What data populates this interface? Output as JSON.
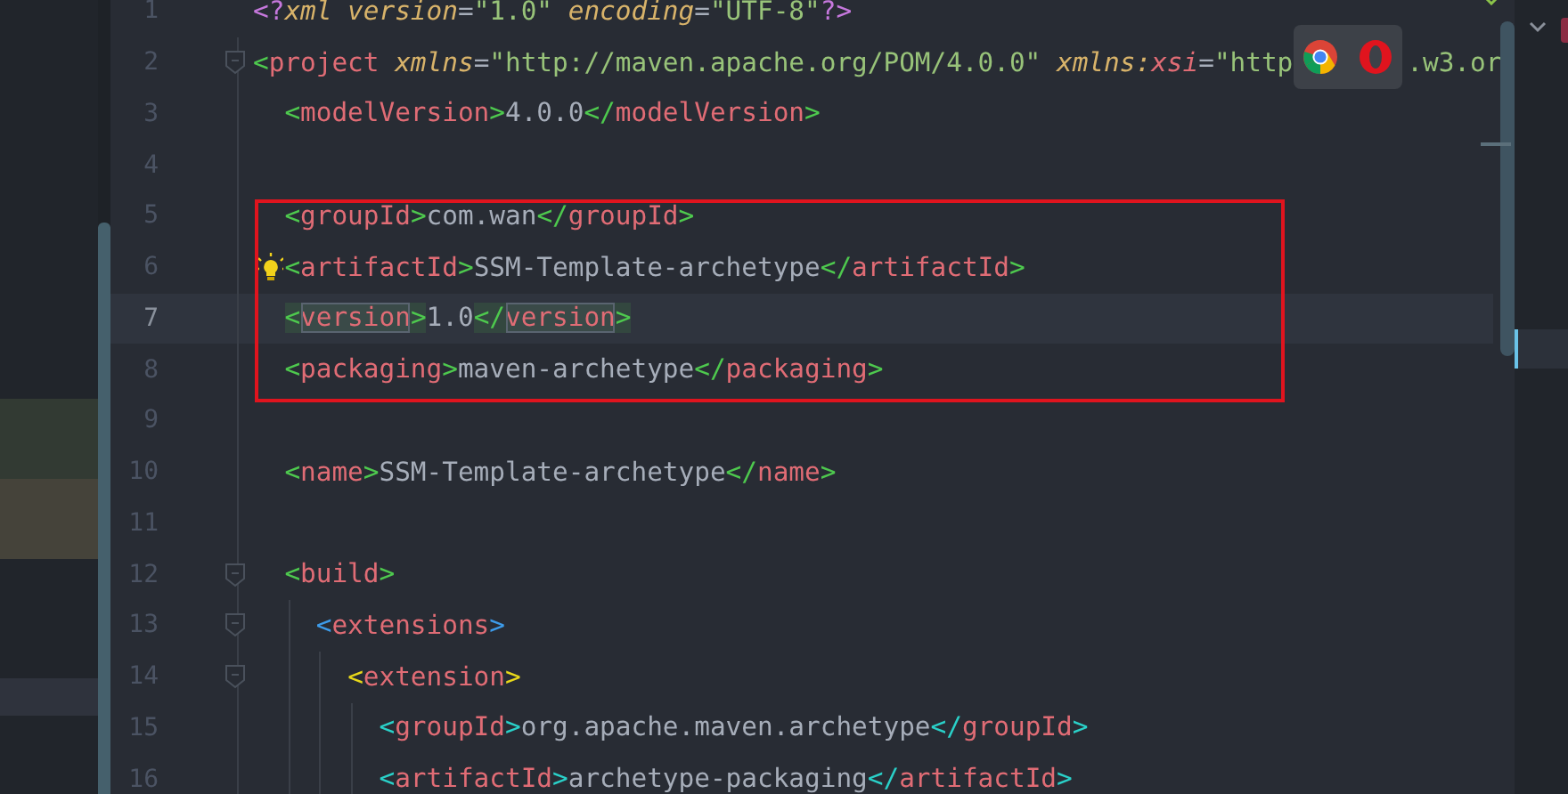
{
  "editor": {
    "lines": [
      {
        "number": "1",
        "foldable": false,
        "current": false,
        "hint": false,
        "bracket_match": false,
        "tokens": [
          {
            "kind": "pi",
            "text": "<?"
          },
          {
            "kind": "attr",
            "text": "xml"
          },
          {
            "kind": "attr",
            "text": " version"
          },
          {
            "kind": "eq",
            "text": "="
          },
          {
            "kind": "string",
            "text": "\"1.0\""
          },
          {
            "kind": "attr",
            "text": " encoding"
          },
          {
            "kind": "eq",
            "text": "="
          },
          {
            "kind": "string",
            "text": "\"UTF-8\""
          },
          {
            "kind": "pi",
            "text": "?>"
          }
        ]
      },
      {
        "number": "2",
        "foldable": true,
        "current": false,
        "hint": false,
        "bracket_match": false,
        "tokens": [
          {
            "kind": "bracket",
            "text": "<"
          },
          {
            "kind": "tag",
            "text": "project"
          },
          {
            "kind": "attr",
            "text": " xmlns"
          },
          {
            "kind": "eq",
            "text": "="
          },
          {
            "kind": "string",
            "text": "\"http://maven.apache.org/POM/4.0.0\""
          },
          {
            "kind": "attr",
            "text": " xmlns:"
          },
          {
            "kind": "ns",
            "text": "xsi"
          },
          {
            "kind": "eq",
            "text": "="
          },
          {
            "kind": "string",
            "text": "\"http"
          }
        ],
        "tokens_after_popup": [
          {
            "kind": "string",
            "text": ".w3.or"
          }
        ]
      },
      {
        "number": "3",
        "foldable": false,
        "current": false,
        "hint": false,
        "bracket_match": false,
        "tokens": [
          {
            "kind": "bracket",
            "text": "  <"
          },
          {
            "kind": "tag",
            "text": "modelVersion"
          },
          {
            "kind": "bracket",
            "text": ">"
          },
          {
            "kind": "text",
            "text": "4.0.0"
          },
          {
            "kind": "bracket",
            "text": "</"
          },
          {
            "kind": "tag",
            "text": "modelVersion"
          },
          {
            "kind": "bracket",
            "text": ">"
          }
        ]
      },
      {
        "number": "4",
        "foldable": false,
        "current": false,
        "hint": false
      },
      {
        "number": "5",
        "foldable": false,
        "current": false,
        "hint": false,
        "bracket_match": false,
        "tokens": [
          {
            "kind": "bracket",
            "text": "  <"
          },
          {
            "kind": "tag",
            "text": "groupId"
          },
          {
            "kind": "bracket",
            "text": ">"
          },
          {
            "kind": "text",
            "text": "com.wan"
          },
          {
            "kind": "bracket",
            "text": "</"
          },
          {
            "kind": "tag",
            "text": "groupId"
          },
          {
            "kind": "bracket",
            "text": ">"
          }
        ]
      },
      {
        "number": "6",
        "foldable": false,
        "current": false,
        "hint": true,
        "bracket_match": false,
        "tokens": [
          {
            "kind": "bracket",
            "text": "  <"
          },
          {
            "kind": "tag",
            "text": "artifactId"
          },
          {
            "kind": "bracket",
            "text": ">"
          },
          {
            "kind": "text",
            "text": "SSM-Template-archetype"
          },
          {
            "kind": "bracket",
            "text": "</"
          },
          {
            "kind": "tag",
            "text": "artifactId"
          },
          {
            "kind": "bracket",
            "text": ">"
          }
        ]
      },
      {
        "number": "7",
        "foldable": false,
        "current": true,
        "hint": false,
        "bracket_match": true,
        "tokens": [
          {
            "kind": "bracket",
            "text": "  <"
          },
          {
            "kind": "tag",
            "text": "version"
          },
          {
            "kind": "bracket",
            "text": ">"
          },
          {
            "kind": "text",
            "text": "1.0"
          },
          {
            "kind": "bracket",
            "text": "</"
          },
          {
            "kind": "tag",
            "text": "version"
          },
          {
            "kind": "bracket",
            "text": ">"
          }
        ]
      },
      {
        "number": "8",
        "foldable": false,
        "current": false,
        "hint": false,
        "bracket_match": false,
        "tokens": [
          {
            "kind": "bracket",
            "text": "  <"
          },
          {
            "kind": "tag",
            "text": "packaging"
          },
          {
            "kind": "bracket",
            "text": ">"
          },
          {
            "kind": "text",
            "text": "maven-archetype"
          },
          {
            "kind": "bracket",
            "text": "</"
          },
          {
            "kind": "tag",
            "text": "packaging"
          },
          {
            "kind": "bracket",
            "text": ">"
          }
        ]
      },
      {
        "number": "9",
        "foldable": false,
        "current": false,
        "hint": false
      },
      {
        "number": "10",
        "foldable": false,
        "current": false,
        "hint": false,
        "bracket_match": false,
        "tokens": [
          {
            "kind": "bracket",
            "text": "  <"
          },
          {
            "kind": "tag",
            "text": "name"
          },
          {
            "kind": "bracket",
            "text": ">"
          },
          {
            "kind": "text",
            "text": "SSM-Template-archetype"
          },
          {
            "kind": "bracket",
            "text": "</"
          },
          {
            "kind": "tag",
            "text": "name"
          },
          {
            "kind": "bracket",
            "text": ">"
          }
        ]
      },
      {
        "number": "11",
        "foldable": false,
        "current": false,
        "hint": false
      },
      {
        "number": "12",
        "foldable": true,
        "current": false,
        "hint": false,
        "bracket_match": false,
        "tokens": [
          {
            "kind": "bracket",
            "text": "  <"
          },
          {
            "kind": "tag",
            "text": "build"
          },
          {
            "kind": "bracket",
            "text": ">"
          }
        ]
      },
      {
        "number": "13",
        "foldable": true,
        "current": false,
        "hint": false,
        "bracket_match": false,
        "tokens": [
          {
            "kind": "bracket",
            "text": "    <"
          },
          {
            "kind": "tag",
            "text": "extensions"
          },
          {
            "kind": "bracket",
            "text": ">"
          }
        ]
      },
      {
        "number": "14",
        "foldable": true,
        "current": false,
        "hint": false,
        "bracket_match": false,
        "tokens": [
          {
            "kind": "bracket",
            "text": "      <"
          },
          {
            "kind": "tag",
            "text": "extension"
          },
          {
            "kind": "bracket",
            "text": ">"
          }
        ]
      },
      {
        "number": "15",
        "foldable": false,
        "current": false,
        "hint": false,
        "bracket_match": false,
        "tokens": [
          {
            "kind": "bracket",
            "text": "        <"
          },
          {
            "kind": "tag",
            "text": "groupId"
          },
          {
            "kind": "bracket",
            "text": ">"
          },
          {
            "kind": "text",
            "text": "org.apache.maven.archetype"
          },
          {
            "kind": "bracket",
            "text": "</"
          },
          {
            "kind": "tag",
            "text": "groupId"
          },
          {
            "kind": "bracket",
            "text": ">"
          }
        ]
      },
      {
        "number": "16",
        "foldable": false,
        "current": false,
        "hint": false,
        "bracket_match": false,
        "tokens": [
          {
            "kind": "bracket",
            "text": "        <"
          },
          {
            "kind": "tag",
            "text": "artifactId"
          },
          {
            "kind": "bracket",
            "text": ">"
          },
          {
            "kind": "text",
            "text": "archetype-packaging"
          },
          {
            "kind": "bracket",
            "text": "</"
          },
          {
            "kind": "tag",
            "text": "artifactId"
          },
          {
            "kind": "bracket",
            "text": ">"
          }
        ]
      }
    ]
  }
}
